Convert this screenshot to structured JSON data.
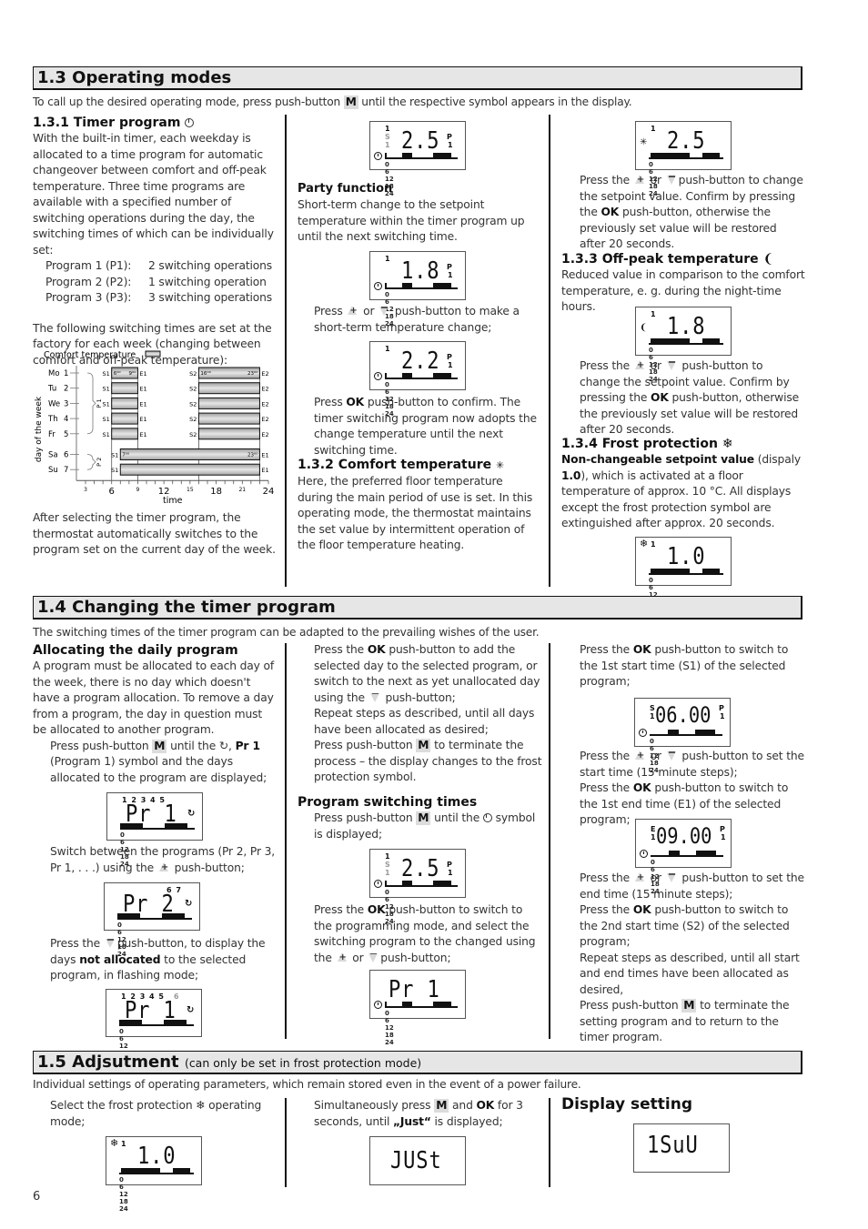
{
  "page_number": "6",
  "section_1_3": {
    "title": "1.3 Operating modes",
    "intro_before": "To call up the desired operating mode, press push-button ",
    "intro_key": "M",
    "intro_after": " until the respective symbol appears in the display.",
    "timer_program": {
      "heading": "1.3.1 Timer program",
      "body": "With the built-in timer, each weekday is allocated to a time program for automatic changeover between comfort and off-peak temperature. Three time programs are available with a specified number of switching operations during the day, the switching times of which can be individually set:",
      "programs": [
        {
          "name": "Program 1 (P1):",
          "ops": "2 switching operations"
        },
        {
          "name": "Program 2 (P2):",
          "ops": "1 switching operation"
        },
        {
          "name": "Program 3 (P3):",
          "ops": "3 switching operations"
        }
      ],
      "factory_text": "The following switching times are set at the factory for each week (changing between comfort and off-peak temperature):",
      "after_text": "After selecting the timer program, the thermostat automatically switches to the program set on the current day of the week."
    },
    "party": {
      "heading": "Party function",
      "body": "Short-term change to the setpoint temperature within the timer program up until the next switching time.",
      "step1_a": "Press ",
      "step1_or": " or ",
      "step1_b": " push-button to make a short-term temperature change;",
      "step2_ok": "OK",
      "step2_text": " push-button to confirm. The timer switching program now adopts the change temperature until the next switching time.",
      "step2_press": "Press "
    },
    "comfort": {
      "heading": "1.3.2 Comfort temperature",
      "body": "Here, the preferred floor temperature during the main period of use is set. In this operating mode, the thermostat maintains the set value by intermittent operation of the floor temperature heating.",
      "press_a": "Press the ",
      "press_or": " or ",
      "press_b": "push-button to change the setpoint value. Confirm by pressing the ",
      "ok": "OK",
      "press_c": " push-button, otherwise the previously set value will be restored after 20 seconds."
    },
    "offpeak": {
      "heading": "1.3.3 Off-peak temperature",
      "body": "Reduced value in comparison to the comfort temperature, e. g. during the night-time hours.",
      "press_a": "Press the ",
      "press_or": " or ",
      "press_b": " push-button to change the setpoint value. Confirm by pressing the ",
      "ok": "OK",
      "press_c": " push-button, otherwise the previously set value will be restored after 20 seconds."
    },
    "frost": {
      "heading": "1.3.4 Frost protection",
      "bold_lead": "Non-changeable setpoint value",
      "body_a": " (dispaly ",
      "value": "1.0",
      "body_b": "), which is activated at a floor temperature of approx. 10 °C. All displays except the frost protection symbol are extinguished after approx. 20 seconds."
    }
  },
  "section_1_4": {
    "title": "1.4 Changing the timer program",
    "intro": "The switching times of the timer program can be adapted to the prevailing wishes of the user.",
    "allocating": {
      "heading": "Allocating the daily program",
      "body": "A program must be allocated to each day of the week, there is no day which doesn't have a program allocation. To remove a day from a program, the day in question must be allocated to another program.",
      "step1_a": "Press push-button ",
      "key": "M",
      "step1_b": " until the ",
      "step1_pr": "Pr 1",
      "step1_c": " (Program 1) symbol and the days allocated to the program are displayed;",
      "step2_a": "Switch between the programs (Pr 2, Pr 3, Pr 1, . . .) using the ",
      "step2_b": " push-button;",
      "step3_a": "Press the ",
      "step3_b": "push-button, to display the days ",
      "step3_bold": "not allocated",
      "step3_c": " to the selected program, in flashing mode;"
    },
    "middle": {
      "step4_a": "Press the ",
      "ok": "OK",
      "step4_b": " push-button to add the selected day to the selected program, or switch to the next as yet unallocated day using the ",
      "step4_c": " push-button;",
      "step5": "Repeat steps as described, until all days have been allocated as desired;",
      "step6_a": "Press push-button ",
      "key": "M",
      "step6_b": " to terminate the process – the display changes to the frost protection symbol."
    },
    "switching_times": {
      "heading": "Program switching times",
      "step1_a": "Press push-button ",
      "key": "M",
      "step1_b": " until the ",
      "step1_c": " symbol is displayed;",
      "step2_a": "Press the ",
      "ok": "OK",
      "step2_b": " push-button to switch to the programming mode, and select the switching program to the changed using the ",
      "step2_or": " or ",
      "step2_c": "push-button;"
    },
    "right": {
      "s1_a": "Press the ",
      "ok": "OK",
      "s1_b": " push-button to switch to the 1st start time (S1) of the selected program;",
      "s2_a": "Press the ",
      "s2_or": " or ",
      "s2_b": " push-button to set the start time (15 minute steps);",
      "s3_a": "Press the ",
      "s3_b": " push-button to switch to the 1st end time (E1) of the selected program;",
      "s4_a": "Press the ",
      "s4_or": " or ",
      "s4_b": " push-button to set the end time (15 minute steps);",
      "s5_a": "Press the ",
      "s5_b": " push-button to switch to the 2nd start time (S2) of the selected program;",
      "s6": "Repeat steps as described, until all start and end times have been allocated as desired,",
      "s7_a": "Press push-button ",
      "key": "M",
      "s7_b": " to terminate the setting program and to return to the timer program."
    }
  },
  "section_1_5": {
    "title": "1.5 Adjsutment",
    "title_note": "(can only be set in frost protection mode)",
    "intro": "Individual settings of operating parameters, which remain stored even in the event of a power failure.",
    "col1": "Select the frost protection ❄ operating mode;",
    "col2_a": "Simultaneously press ",
    "key": "M",
    "col2_and": " and ",
    "ok": "OK",
    "col2_b": " for 3 seconds, until ",
    "col2_just": "„Just“",
    "col2_c": " is displayed;",
    "display_heading": "Display setting"
  },
  "lcd": {
    "timer_25": {
      "top": "1",
      "left_s": "S",
      "left_1": "1",
      "value": "2.5",
      "p": "P",
      "p1": "1"
    },
    "party_18": {
      "top": "1",
      "value": "1.8",
      "p": "P",
      "p1": "1"
    },
    "party_22": {
      "top": "1",
      "value": "2.2",
      "p": "P",
      "p1": "1"
    },
    "comfort_25": {
      "top": "1",
      "value": "2.5"
    },
    "offpeak_18": {
      "top": "1",
      "value": "1.8"
    },
    "frost_10": {
      "top": "1",
      "value": "1.0"
    },
    "pr1_days": {
      "days": "1 2 3 4 5",
      "value": "Pr 1"
    },
    "pr2_days": {
      "days": "6 7",
      "value": "Pr 2"
    },
    "pr1_flash": {
      "days": "1 2 3 4 5",
      "flash": "6",
      "value": "Pr 1"
    },
    "switch_25": {
      "top": "1",
      "left_s": "S",
      "left_1": "1",
      "value": "2.5",
      "p": "P",
      "p1": "1"
    },
    "switch_pr1": {
      "value": "Pr 1"
    },
    "s1_time": {
      "label": "S",
      "label2": "1",
      "value": "06.00",
      "p": "P",
      "p1": "1"
    },
    "e1_time": {
      "label": "E",
      "label2": "1",
      "value": "09.00",
      "p": "P",
      "p1": "1"
    },
    "adj_frost": {
      "top": "1",
      "value": "1.0"
    },
    "just": {
      "value": "JUSt"
    },
    "display_setting": {
      "value": "1SuU",
      "small": "1"
    },
    "tick_labels": [
      "0",
      "6",
      "12",
      "18",
      "24"
    ]
  },
  "chart_data": {
    "type": "bar",
    "title": "",
    "legend": "Comfort temperature",
    "xlabel": "time",
    "ylabel": "day of the week",
    "xlim": [
      0,
      24
    ],
    "x_ticks_major": [
      "6",
      "12",
      "18",
      "24"
    ],
    "x_ticks_minor": [
      "3",
      "9",
      "15",
      "21"
    ],
    "days": [
      {
        "abbr": "Mo",
        "num": "1",
        "program": "P1",
        "periods": [
          {
            "start": 6,
            "end": 9,
            "s": "S1",
            "e": "E1",
            "start_label": "6⁰⁰",
            "end_label": "9⁰⁰"
          },
          {
            "start": 16,
            "end": 23,
            "s": "S2",
            "e": "E2",
            "start_label": "16⁰⁰",
            "end_label": "23⁰⁰"
          }
        ]
      },
      {
        "abbr": "Tu",
        "num": "2",
        "program": "P1",
        "periods": [
          {
            "start": 6,
            "end": 9,
            "s": "S1",
            "e": "E1"
          },
          {
            "start": 16,
            "end": 23,
            "s": "S2",
            "e": "E2"
          }
        ]
      },
      {
        "abbr": "We",
        "num": "3",
        "program": "P1",
        "periods": [
          {
            "start": 6,
            "end": 9,
            "s": "S1",
            "e": "E1"
          },
          {
            "start": 16,
            "end": 23,
            "s": "S2",
            "e": "E2"
          }
        ]
      },
      {
        "abbr": "Th",
        "num": "4",
        "program": "P1",
        "periods": [
          {
            "start": 6,
            "end": 9,
            "s": "S1",
            "e": "E1"
          },
          {
            "start": 16,
            "end": 23,
            "s": "S2",
            "e": "E2"
          }
        ]
      },
      {
        "abbr": "Fr",
        "num": "5",
        "program": "P1",
        "periods": [
          {
            "start": 6,
            "end": 9,
            "s": "S1",
            "e": "E1"
          },
          {
            "start": 16,
            "end": 23,
            "s": "S2",
            "e": "E2"
          }
        ]
      },
      {
        "abbr": "Sa",
        "num": "6",
        "program": "P2",
        "periods": [
          {
            "start": 7,
            "end": 23,
            "s": "S1",
            "e": "E1",
            "start_label": "7⁰⁰",
            "end_label": "23⁰⁰"
          }
        ]
      },
      {
        "abbr": "Su",
        "num": "7",
        "program": "P2",
        "periods": [
          {
            "start": 7,
            "end": 23,
            "s": "S1",
            "e": "E1"
          }
        ]
      }
    ],
    "groups": [
      {
        "label": "P 1",
        "from": 1,
        "to": 5
      },
      {
        "label": "P 2",
        "from": 6,
        "to": 7
      }
    ]
  }
}
